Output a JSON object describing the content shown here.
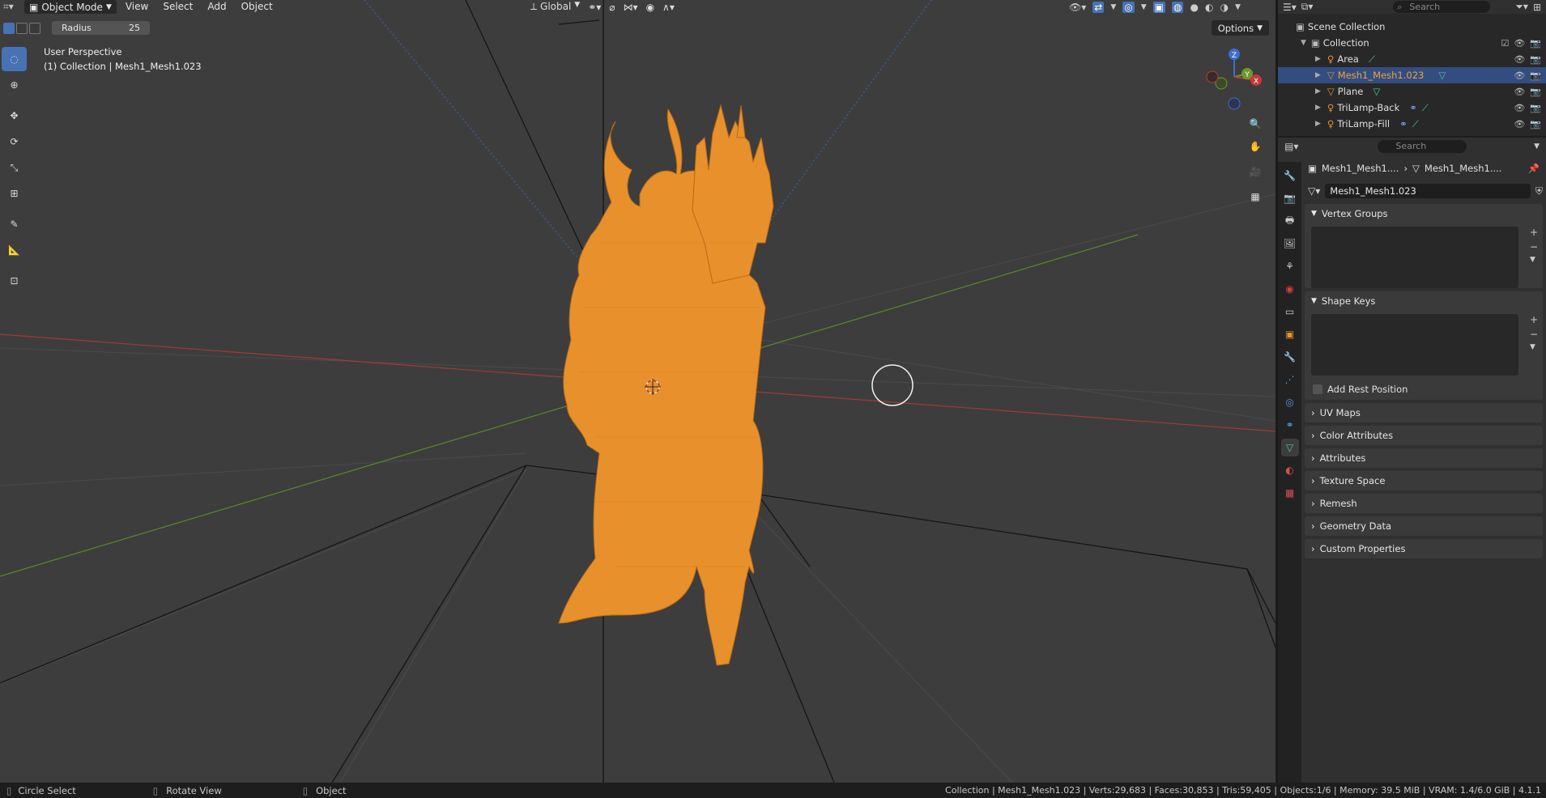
{
  "viewport": {
    "menu": {
      "mode": "Object Mode",
      "items": [
        "View",
        "Select",
        "Add",
        "Object"
      ]
    },
    "transform_orientation": "Global",
    "radius_label": "Radius",
    "radius_value": "25",
    "options_label": "Options",
    "search_placeholder": "Search",
    "perspective_text": "User Perspective",
    "collection_text": "(1) Collection | Mesh1_Mesh1.023",
    "gizmo_axes": {
      "z": "Z",
      "y": "Y",
      "x": "X"
    },
    "colors": {
      "selection": "#f0902a",
      "x_axis": "#c03a3a",
      "y_axis": "#6a9a2a",
      "accent": "#4772b3"
    }
  },
  "outliner": {
    "search_placeholder": "Search",
    "scene_collection": "Scene Collection",
    "collection": "Collection",
    "items": [
      {
        "label": "Area"
      },
      {
        "label": "Mesh1_Mesh1.023"
      },
      {
        "label": "Plane"
      },
      {
        "label": "TriLamp-Back"
      },
      {
        "label": "TriLamp-Fill"
      }
    ]
  },
  "properties": {
    "search_placeholder": "Search",
    "breadcrumb_object": "Mesh1_Mesh1....",
    "breadcrumb_mesh": "Mesh1_Mesh1....",
    "mesh_name": "Mesh1_Mesh1.023",
    "panels": {
      "vertex_groups": "Vertex Groups",
      "shape_keys": "Shape Keys",
      "add_rest_position": "Add Rest Position",
      "uv_maps": "UV Maps",
      "color_attributes": "Color Attributes",
      "attributes": "Attributes",
      "texture_space": "Texture Space",
      "remesh": "Remesh",
      "geometry_data": "Geometry Data",
      "custom_properties": "Custom Properties"
    }
  },
  "status": {
    "left1": "Circle Select",
    "left2": "Rotate View",
    "left3": "Object",
    "stats": "Collection | Mesh1_Mesh1.023 | Verts:29,683 | Faces:30,853 | Tris:59,405 | Objects:1/6 | Memory: 39.5 MiB | VRAM: 1.4/6.0 GiB | 4.1.1"
  }
}
